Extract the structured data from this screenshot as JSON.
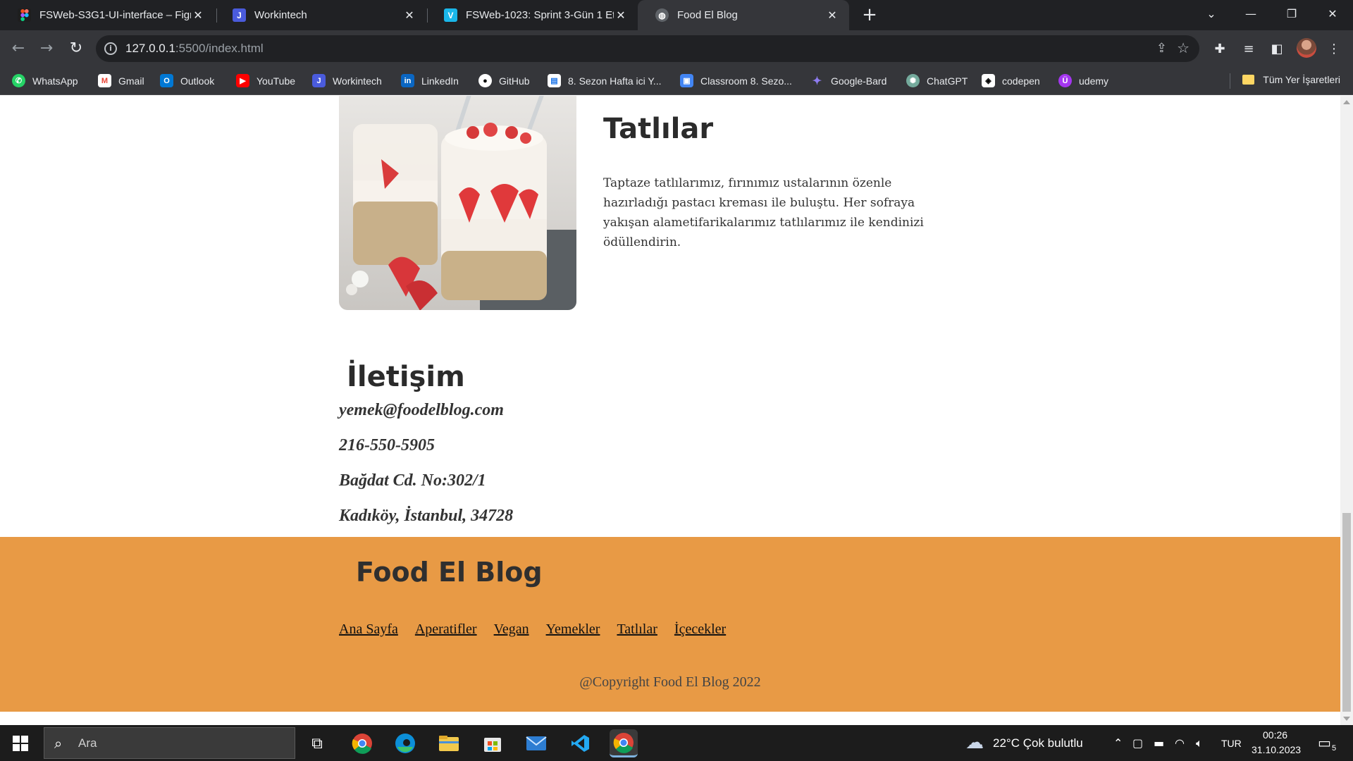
{
  "tabs": [
    {
      "title": "FSWeb-S3G1-UI-interface – Figm",
      "icon": "figma-icon",
      "color": "#1e1e1e"
    },
    {
      "title": "Workintech",
      "icon": "workintech-icon",
      "color": "#4a5bdc"
    },
    {
      "title": "FSWeb-1023: Sprint 3-Gün 1 Etü",
      "icon": "vimeo-icon",
      "color": "#1ab7ea"
    },
    {
      "title": "Food El Blog",
      "icon": "globe-icon",
      "color": "#9aa0a6"
    }
  ],
  "window_controls": {
    "minimize": "—",
    "restore": "❐",
    "close": "✕",
    "tab_search": "⌄"
  },
  "address": {
    "host": "127.0.0.1",
    "path": ":5500/index.html"
  },
  "bookmarks": [
    {
      "label": "WhatsApp",
      "icon": "whatsapp-icon",
      "color": "#25d366"
    },
    {
      "label": "Gmail",
      "icon": "gmail-icon",
      "color": "#ea4335"
    },
    {
      "label": "Outlook",
      "icon": "outlook-icon",
      "color": "#0078d4"
    },
    {
      "label": "YouTube",
      "icon": "youtube-icon",
      "color": "#ff0000"
    },
    {
      "label": "Workintech",
      "icon": "workintech-icon",
      "color": "#4a5bdc"
    },
    {
      "label": "LinkedIn",
      "icon": "linkedin-icon",
      "color": "#0a66c2"
    },
    {
      "label": "GitHub",
      "icon": "github-icon",
      "color": "#ffffff"
    },
    {
      "label": "8. Sezon Hafta ici Y...",
      "icon": "doc-icon",
      "color": "#ffffff"
    },
    {
      "label": "Classroom 8. Sezo...",
      "icon": "classroom-icon",
      "color": "#4285f4"
    },
    {
      "label": "Google-Bard",
      "icon": "bard-icon",
      "color": "#8e7cf0"
    },
    {
      "label": "ChatGPT",
      "icon": "chatgpt-icon",
      "color": "#74aa9c"
    },
    {
      "label": "codepen",
      "icon": "codepen-icon",
      "color": "#ffffff"
    },
    {
      "label": "udemy",
      "icon": "udemy-icon",
      "color": "#a435f0"
    }
  ],
  "all_bookmarks_label": "Tüm Yer İşaretleri",
  "page": {
    "dessert_section": {
      "title": "Tatlılar",
      "text": "Taptaze tatlılarımız, fırınımız ustalarının özenle hazırladığı pastacı kreması ile buluştu. Her sofraya yakışan alametifarikalarımız tatlılarımız ile kendinizi ödüllendirin."
    },
    "contact": {
      "title": "İletişim",
      "lines": [
        "yemek@foodelblog.com",
        "216-550-5905",
        "Bağdat Cd. No:302/1",
        "Kadıköy, İstanbul, 34728"
      ]
    },
    "footer": {
      "title": "Food El Blog",
      "links": [
        "Ana Sayfa",
        "Aperatifler",
        "Vegan",
        "Yemekler",
        "Tatlılar",
        "İçecekler"
      ],
      "copyright": "@Copyright Food El Blog 2022"
    }
  },
  "taskbar": {
    "search_placeholder": "Ara",
    "weather": "22°C  Çok bulutlu",
    "language": "TUR",
    "time": "00:26",
    "date": "31.10.2023",
    "notifications": "5"
  }
}
